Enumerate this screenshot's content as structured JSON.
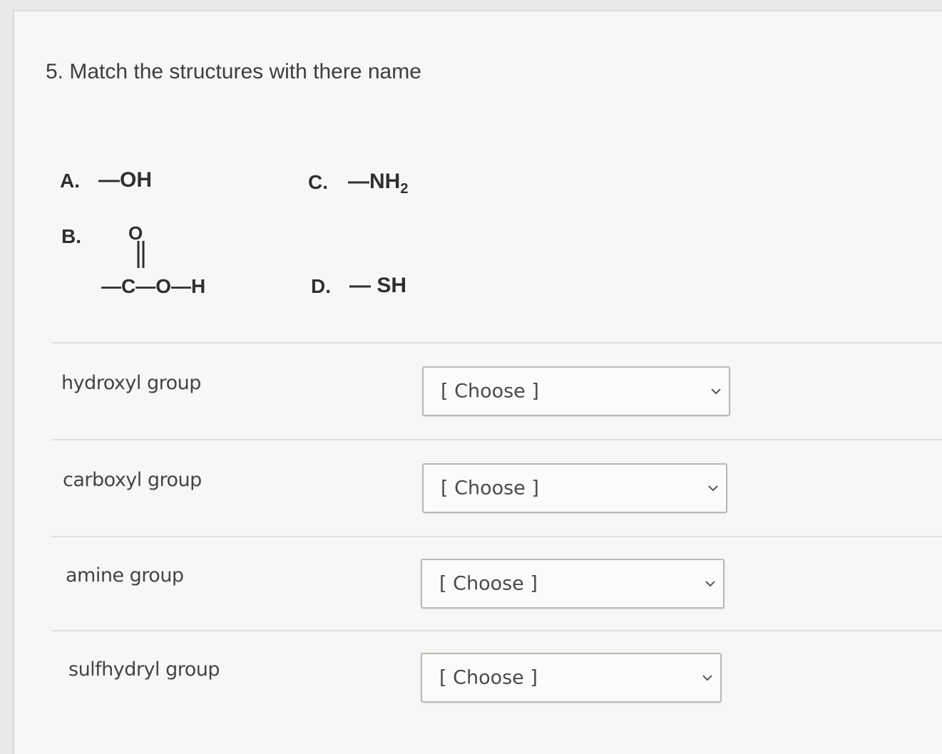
{
  "question": {
    "title": "5. Match the structures with there name"
  },
  "structures": [
    {
      "label": "A.",
      "formula": "—OH"
    },
    {
      "label": "B.",
      "formula_top": "O",
      "formula_main": "—C—O—H"
    },
    {
      "label": "C.",
      "formula": "—NH",
      "subscript": "2"
    },
    {
      "label": "D.",
      "formula": "— SH"
    }
  ],
  "rows": [
    {
      "label": "hydroxyl group",
      "selected": "[ Choose ]"
    },
    {
      "label": "carboxyl group",
      "selected": "[ Choose ]"
    },
    {
      "label": "amine group",
      "selected": "[ Choose ]"
    },
    {
      "label": "sulfhydryl group",
      "selected": "[ Choose ]"
    }
  ],
  "icons": {
    "dropdown": "chevron-down-icon"
  },
  "colors": {
    "background": "#f7f7f5",
    "text": "#3b3b3b",
    "border": "#b8b8b6"
  }
}
